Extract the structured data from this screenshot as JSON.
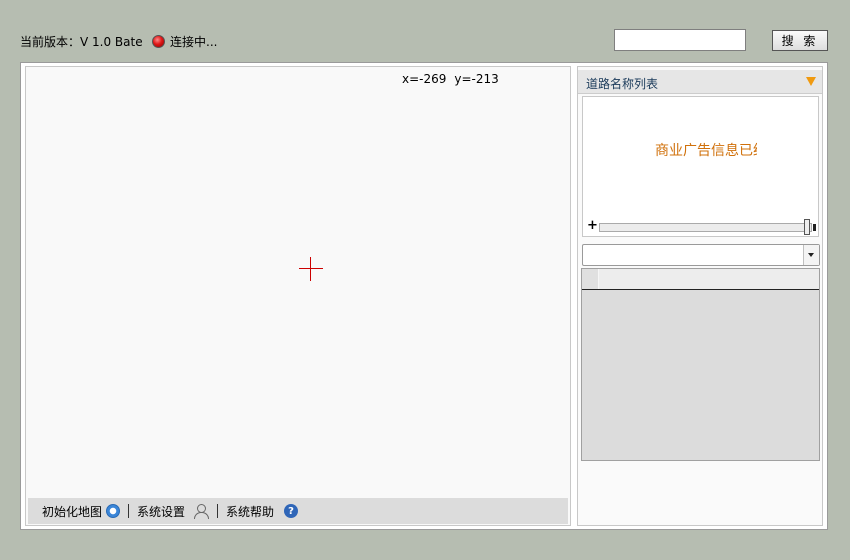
{
  "header": {
    "version_text": "当前版本：V 1.0 Bate",
    "status_text": "连接中...",
    "search_placeholder": "",
    "search_value": "",
    "search_button_label": "搜 索"
  },
  "map": {
    "coord_x": "x=-269",
    "coord_y": "y=-213"
  },
  "map_toolbar": {
    "init_map_label": "初始化地图",
    "settings_label": "系统设置",
    "help_label": "系统帮助",
    "help_icon_glyph": "?"
  },
  "side_panel": {
    "title": "道路名称列表",
    "ad_text": "商业广告信息已经",
    "slider_plus": "+",
    "slider_value": 1.0,
    "combo_value": ""
  },
  "colors": {
    "page_bg": "#b6bdb1",
    "accent_orange": "#f09a10",
    "ad_text": "#d0700a",
    "crosshair": "#cc0000",
    "status_red": "#e01818"
  },
  "icons": [
    "status-indicator-icon",
    "refresh-icon",
    "user-icon",
    "help-icon",
    "collapse-arrow-icon",
    "crosshair-icon",
    "dropdown-arrow-icon"
  ]
}
